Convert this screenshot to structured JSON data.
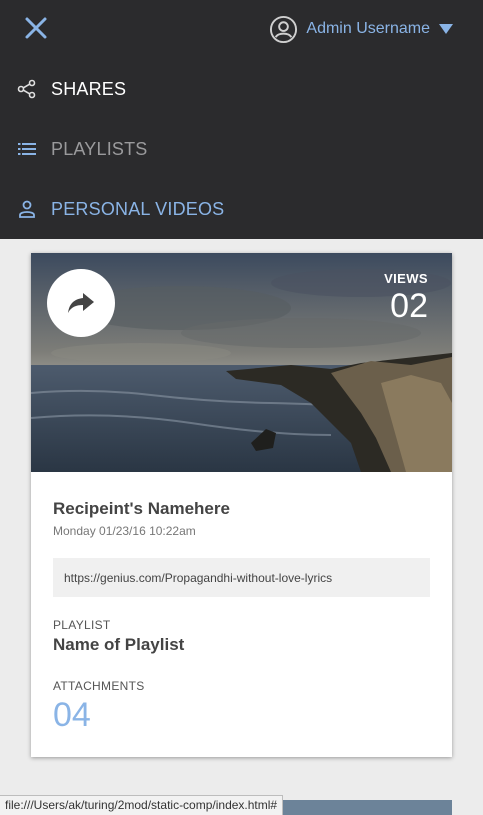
{
  "header": {
    "user_name": "Admin Username",
    "icons": {
      "close": "close-icon",
      "avatar": "user-circle-icon",
      "caret": "caret-down-icon"
    }
  },
  "nav": {
    "items": [
      {
        "label": "SHARES",
        "icon": "share-icon"
      },
      {
        "label": "PLAYLISTS",
        "icon": "list-icon"
      },
      {
        "label": "PERSONAL VIDEOS",
        "icon": "person-icon"
      }
    ]
  },
  "card": {
    "views_label": "VIEWS",
    "views_count": "02",
    "recipient": "Recipeint's Namehere",
    "date": "Monday 01/23/16 10:22am",
    "link": "https://genius.com/Propagandhi-without-love-lyrics",
    "playlist_label": "PLAYLIST",
    "playlist_name": "Name of Playlist",
    "attachments_label": "ATTACHMENTS",
    "attachments_count": "04"
  },
  "statusbar": {
    "url": "file:///Users/ak/turing/2mod/static-comp/index.html#"
  },
  "colors": {
    "topbar_bg": "#2b2b2d",
    "accent": "#8ab4e6",
    "page_bg": "#ececec"
  }
}
